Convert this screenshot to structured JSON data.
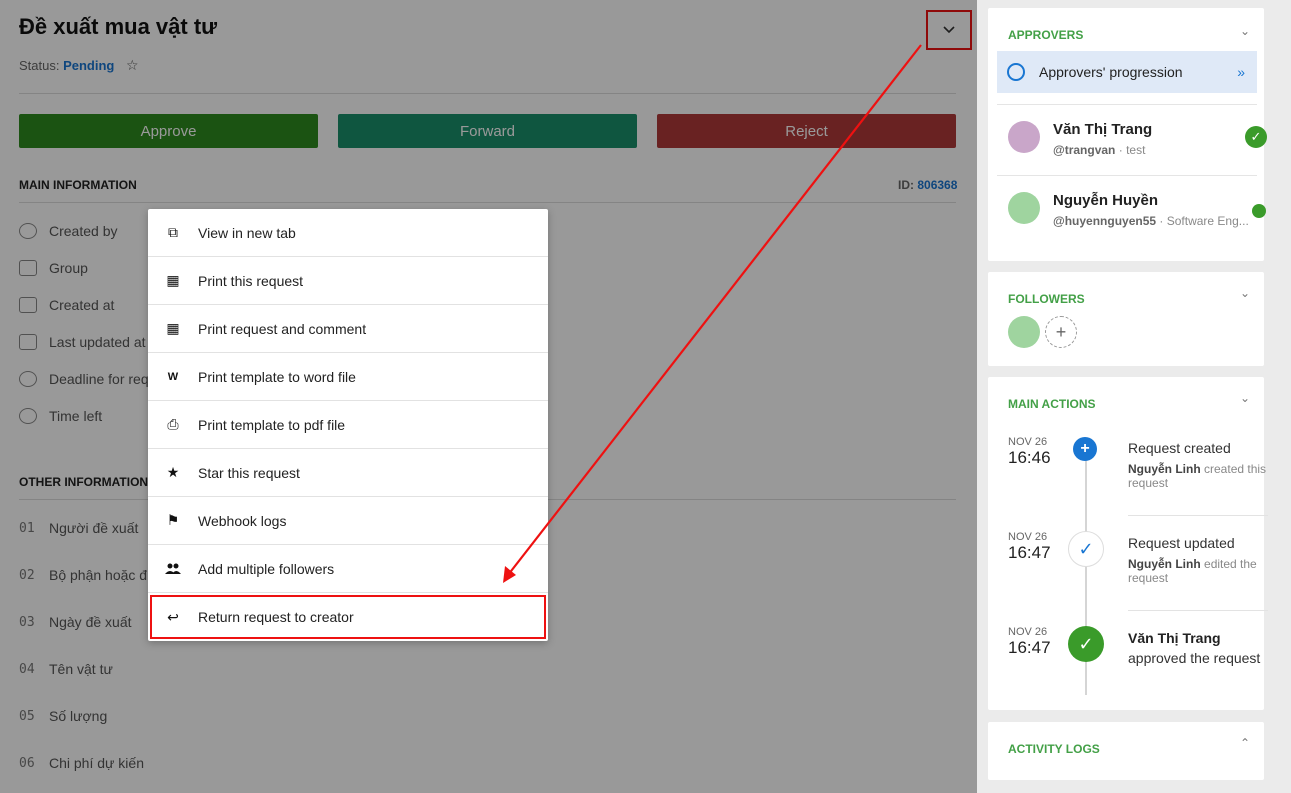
{
  "header": {
    "title": "Đề xuất mua vật tư",
    "status_label": "Status:",
    "status_value": "Pending",
    "star_glyph": "☆",
    "caret_glyph": "⌄"
  },
  "actions": {
    "approve": "Approve",
    "forward": "Forward",
    "reject": "Reject"
  },
  "colors": {
    "approve": "#2e8b1e",
    "forward": "#1a8f6c",
    "reject": "#7b2323",
    "accent_green": "#43a047",
    "accent_blue": "#1976d2",
    "highlight_red": "#ee1111"
  },
  "main_info": {
    "heading": "MAIN INFORMATION",
    "id_label": "ID:",
    "id_value": "806368",
    "fields": [
      "Created by",
      "Group",
      "Created at",
      "Last updated at",
      "Deadline for req",
      "Time left"
    ]
  },
  "other_info": {
    "heading": "OTHER INFORMATION",
    "fields": [
      {
        "num": "01",
        "label": "Người đề xuất"
      },
      {
        "num": "02",
        "label": "Bộ phận hoặc đị"
      },
      {
        "num": "03",
        "label": "Ngày đề xuất"
      },
      {
        "num": "04",
        "label": "Tên vật tư"
      },
      {
        "num": "05",
        "label": "Số lượng"
      },
      {
        "num": "06",
        "label": "Chi phí dự kiến"
      }
    ]
  },
  "menu": {
    "items": [
      {
        "label": "View in new tab",
        "icon": "external-link-icon",
        "glyph": "⧉"
      },
      {
        "label": "Print this request",
        "icon": "printer-icon",
        "glyph": "▦"
      },
      {
        "label": "Print request and comment",
        "icon": "printer-icon",
        "glyph": "▦"
      },
      {
        "label": "Print template to word file",
        "icon": "word-file-icon",
        "glyph": "W"
      },
      {
        "label": "Print template to pdf file",
        "icon": "pdf-file-icon",
        "glyph": "⎙"
      },
      {
        "label": "Star this request",
        "icon": "star-icon",
        "glyph": "★"
      },
      {
        "label": "Webhook logs",
        "icon": "flag-icon",
        "glyph": "⚑"
      },
      {
        "label": "Add multiple followers",
        "icon": "users-icon",
        "glyph": "👥"
      },
      {
        "label": "Return request to creator",
        "icon": "reply-icon",
        "glyph": "↩"
      }
    ]
  },
  "approvers": {
    "heading": "APPROVERS",
    "progression_label": "Approvers' progression",
    "list": [
      {
        "name": "Văn Thị Trang",
        "handle": "@trangvan",
        "role": "test"
      },
      {
        "name": "Nguyễn Huyền",
        "handle": "@huyennguyen55",
        "role": "Software Eng..."
      }
    ]
  },
  "followers": {
    "heading": "FOLLOWERS"
  },
  "main_actions": {
    "heading": "MAIN ACTIONS",
    "events": [
      {
        "date": "NOV 26",
        "time": "16:46",
        "title": "Request created",
        "actor": "Nguyễn Linh",
        "desc": "created this request"
      },
      {
        "date": "NOV 26",
        "time": "16:47",
        "title": "Request updated",
        "actor": "Nguyễn Linh",
        "desc": "edited the request"
      },
      {
        "date": "NOV 26",
        "time": "16:47",
        "title": "Văn Thị Trang",
        "actor": "",
        "desc": "approved the request"
      }
    ]
  },
  "activity_logs": {
    "heading": "ACTIVITY LOGS"
  }
}
